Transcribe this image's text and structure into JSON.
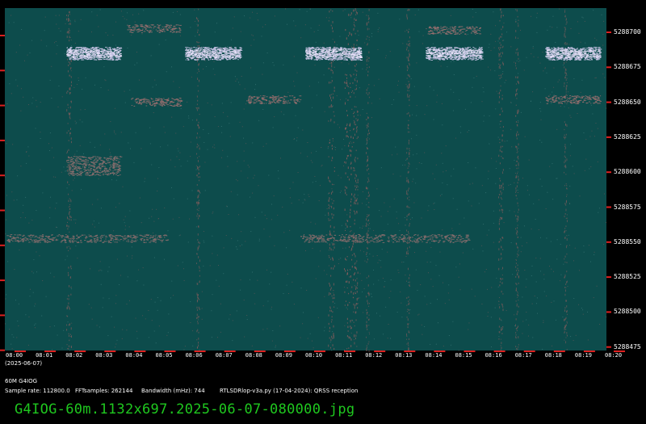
{
  "meta": {
    "date_label": "(2025-06-07)"
  },
  "y_axis": {
    "labels": [
      "5288700",
      "5288675",
      "5288650",
      "5288625",
      "5288600",
      "5288575",
      "5288550",
      "5288525",
      "5288500",
      "5288475"
    ]
  },
  "x_axis": {
    "labels": [
      "08:00",
      "08:01",
      "08:02",
      "08:03",
      "08:04",
      "08:05",
      "08:06",
      "08:07",
      "08:08",
      "08:09",
      "08:10",
      "08:11",
      "08:12",
      "08:13",
      "08:14",
      "08:15",
      "08:16",
      "08:17",
      "08:18",
      "08:19",
      "08:20"
    ]
  },
  "info": {
    "station": "60M G4IOG",
    "sample_rate": "Sample rate: 112800.0",
    "fft_samples": "FFTsamples: 262144",
    "bandwidth": "Bandwidth (mHz): 744",
    "software": "RTLSDRlop-v3a.py (17-04-2024): QRSS reception"
  },
  "footer": {
    "filename": "G4IOG-60m.1132x697.2025-06-07-080000.jpg"
  },
  "colors": {
    "background": "#0d4c4c",
    "ticks": "#dd2020",
    "title": "#1fc81f"
  }
}
